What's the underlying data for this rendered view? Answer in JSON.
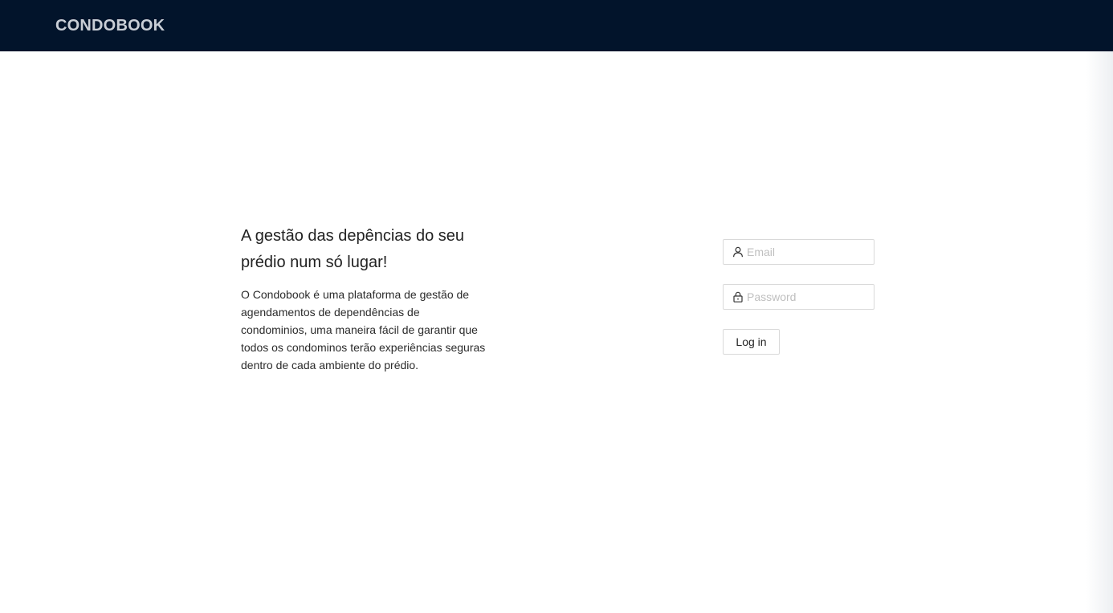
{
  "header": {
    "brand": "CONDOBOOK",
    "background_color": "#02142b",
    "brand_color": "#c9ced6"
  },
  "intro": {
    "headline": "A gestão das depências do seu prédio num só lugar!",
    "description": "O Condobook é uma plataforma de gestão de agendamentos de dependências de condominios, uma maneira fácil de garantir que todos os condominos terão experiências seguras dentro de cada ambiente do prédio."
  },
  "login": {
    "email": {
      "placeholder": "Email",
      "value": "",
      "icon": "user-icon"
    },
    "password": {
      "placeholder": "Password",
      "value": "",
      "icon": "lock-icon"
    },
    "submit_label": "Log in"
  }
}
